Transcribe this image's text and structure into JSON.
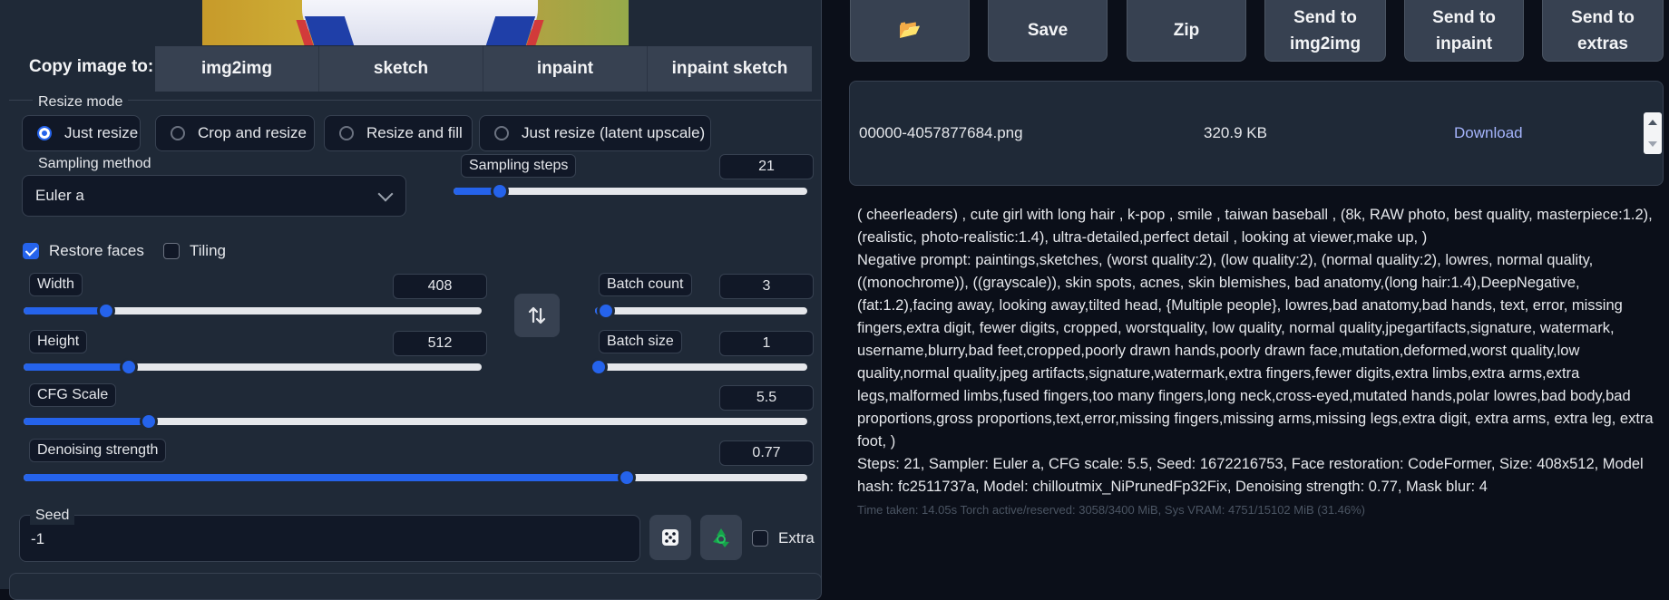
{
  "left": {
    "copy_label": "Copy image to:",
    "copy_buttons": [
      "img2img",
      "sketch",
      "inpaint",
      "inpaint sketch"
    ],
    "resize_mode": {
      "label": "Resize mode",
      "options": [
        "Just resize",
        "Crop and resize",
        "Resize and fill",
        "Just resize (latent upscale)"
      ],
      "selected": "Just resize"
    },
    "sampling_method": {
      "label": "Sampling method",
      "value": "Euler a"
    },
    "sampling_steps": {
      "label": "Sampling steps",
      "value": "21",
      "fraction": 0.13
    },
    "restore_faces": {
      "label": "Restore faces",
      "checked": true
    },
    "tiling": {
      "label": "Tiling",
      "checked": false
    },
    "width": {
      "label": "Width",
      "value": "408",
      "fraction": 0.18
    },
    "height": {
      "label": "Height",
      "value": "512",
      "fraction": 0.23
    },
    "batch_count": {
      "label": "Batch count",
      "value": "3",
      "fraction": 0.05
    },
    "batch_size": {
      "label": "Batch size",
      "value": "1",
      "fraction": 0.0
    },
    "cfg_scale": {
      "label": "CFG Scale",
      "value": "5.5",
      "fraction": 0.16
    },
    "denoising": {
      "label": "Denoising strength",
      "value": "0.77",
      "fraction": 0.77
    },
    "seed": {
      "label": "Seed",
      "value": "-1"
    },
    "extra": {
      "label": "Extra",
      "checked": false
    },
    "icons": [
      "swap-icon",
      "dice-icon",
      "recycle-icon"
    ]
  },
  "right": {
    "buttons": [
      "📂",
      "Save",
      "Zip",
      "Send to img2img",
      "Send to inpaint",
      "Send to extras"
    ],
    "file": {
      "name": "00000-4057877684.png",
      "size": "320.9 KB",
      "download": "Download"
    },
    "prompt": "( cheerleaders) , cute girl with long hair , k-pop , smile , taiwan baseball , (8k, RAW photo, best quality, masterpiece:1.2), (realistic, photo-realistic:1.4), ultra-detailed,perfect detail , looking at viewer,make up, )",
    "negative": "Negative prompt: paintings,sketches, (worst quality:2), (low quality:2), (normal quality:2), lowres, normal quality, ((monochrome)), ((grayscale)), skin spots, acnes, skin blemishes, bad anatomy,(long hair:1.4),DeepNegative, (fat:1.2),facing away, looking away,tilted head, {Multiple people}, lowres,bad anatomy,bad hands, text, error, missing fingers,extra digit, fewer digits, cropped, worstquality, low quality, normal quality,jpegartifacts,signature, watermark, username,blurry,bad feet,cropped,poorly drawn hands,poorly drawn face,mutation,deformed,worst quality,low quality,normal quality,jpeg artifacts,signature,watermark,extra fingers,fewer digits,extra limbs,extra arms,extra legs,malformed limbs,fused fingers,too many fingers,long neck,cross-eyed,mutated hands,polar lowres,bad body,bad proportions,gross proportions,text,error,missing fingers,missing arms,missing legs,extra digit, extra arms, extra leg, extra foot, )",
    "params": "Steps: 21, Sampler: Euler a, CFG scale: 5.5, Seed: 1672216753, Face restoration: CodeFormer, Size: 408x512, Model hash: fc2511737a, Model: chilloutmix_NiPrunedFp32Fix, Denoising strength: 0.77, Mask blur: 4",
    "time": "Time taken: 14.05s  Torch active/reserved: 3058/3400 MiB, Sys VRAM: 4751/15102 MiB (31.46%)"
  },
  "colors": {
    "accent": "#2563eb",
    "panel": "#1f2937",
    "background": "#0b0f19",
    "link": "#a5b4fc"
  }
}
